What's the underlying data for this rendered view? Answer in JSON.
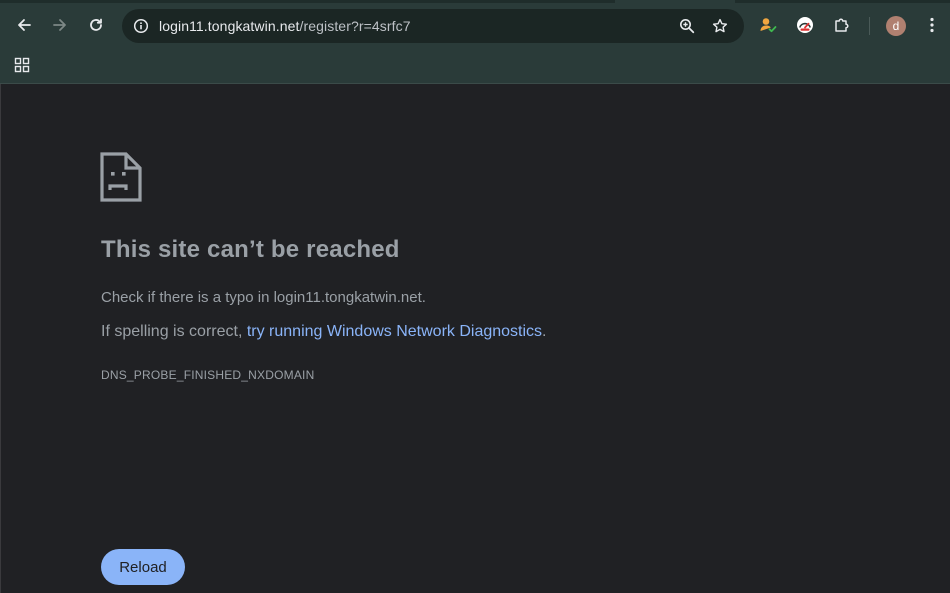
{
  "toolbar": {
    "back_icon": "arrow-left-icon",
    "forward_icon": "arrow-right-icon",
    "reload_icon": "reload-icon",
    "url_host": "login11.tongkatwin.net",
    "url_path": "/register?r=4srfc7",
    "site_info_icon": "site-info-icon",
    "zoom_icon": "zoom-icon",
    "bookmark_icon": "star-icon",
    "extension_icons": [
      "profile-check-extension-icon",
      "speedometer-extension-icon",
      "puzzle-extensions-icon"
    ],
    "profile_initial": "d",
    "menu_icon": "kebab-menu-icon"
  },
  "bookmarks": {
    "apps_icon": "apps-grid-icon"
  },
  "error_page": {
    "icon": "sad-page-icon",
    "title": "This site can’t be reached",
    "line1": "Check if there is a typo in login11.tongkatwin.net.",
    "line2_prefix": "If spelling is correct, ",
    "line2_link": "try running Windows Network Diagnostics",
    "line2_suffix": ".",
    "error_code": "DNS_PROBE_FINISHED_NXDOMAIN",
    "reload_label": "Reload"
  },
  "colors": {
    "toolbar_bg": "#2a3b39",
    "omnibox_bg": "#1b2624",
    "page_bg": "#202124",
    "text_secondary": "#9aa0a6",
    "link": "#8ab4f8",
    "button_bg": "#8ab4f8"
  }
}
